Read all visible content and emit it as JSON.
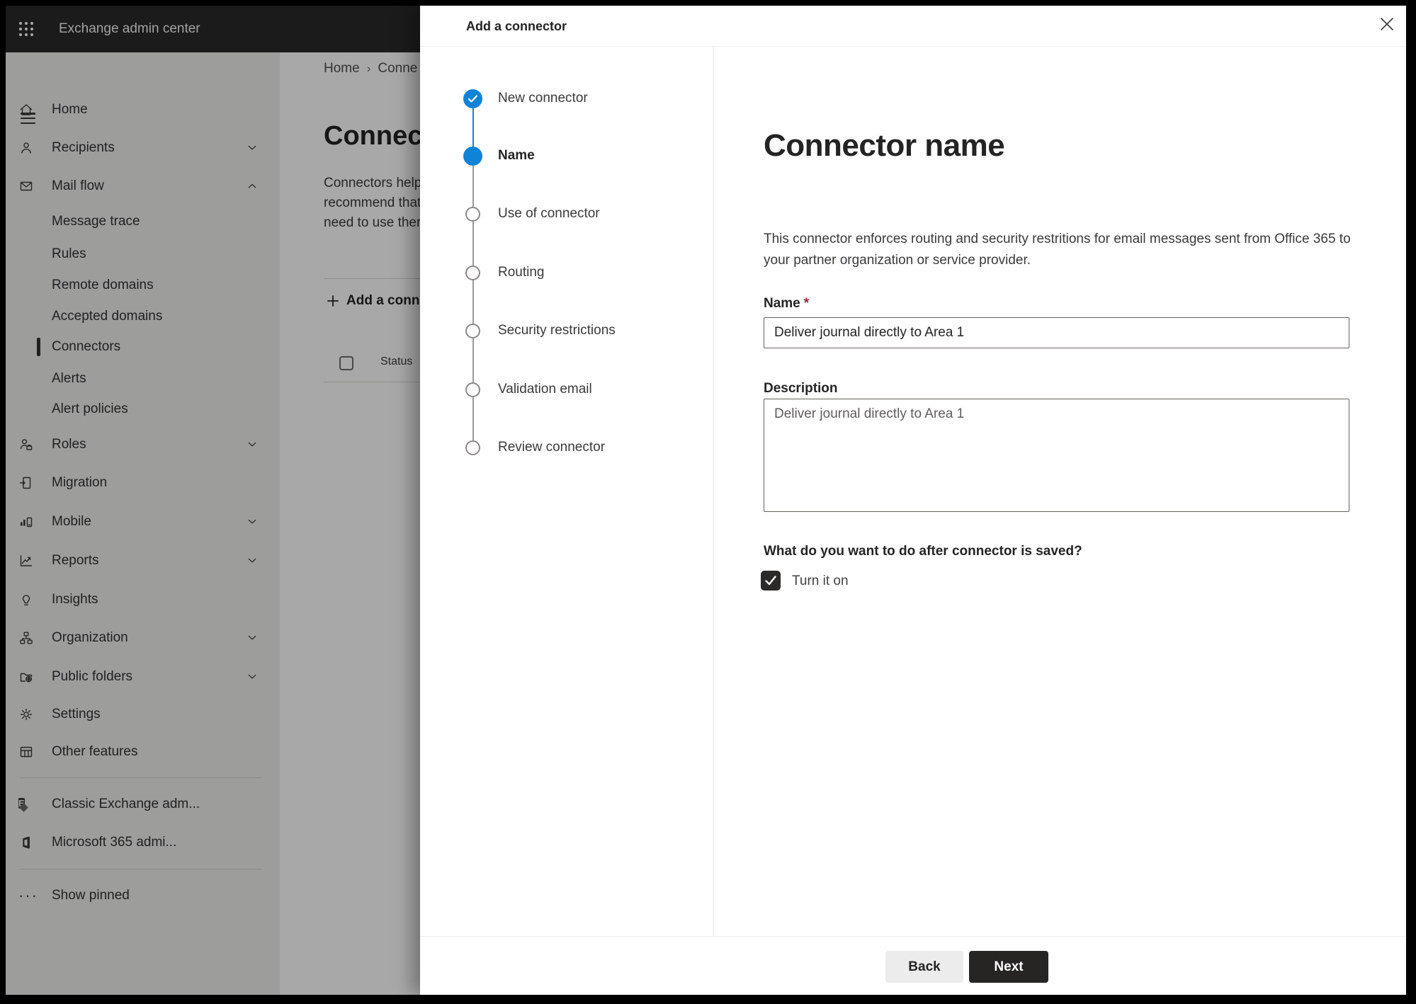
{
  "topbar": {
    "title": "Exchange admin center",
    "app_launcher_icon": "waffle-grid"
  },
  "sidebar": {
    "menu_icon": "hamburger",
    "items": [
      {
        "label": "Home",
        "icon": "home-icon"
      },
      {
        "label": "Recipients",
        "icon": "person-icon",
        "chevron": "down"
      },
      {
        "label": "Mail flow",
        "icon": "mail-icon",
        "chevron": "up",
        "expanded": true
      },
      {
        "label": "Message trace",
        "indent": true
      },
      {
        "label": "Rules",
        "indent": true
      },
      {
        "label": "Remote domains",
        "indent": true
      },
      {
        "label": "Accepted domains",
        "indent": true
      },
      {
        "label": "Connectors",
        "indent": true,
        "selected": true
      },
      {
        "label": "Alerts",
        "indent": true
      },
      {
        "label": "Alert policies",
        "indent": true
      },
      {
        "label": "Roles",
        "icon": "roles-icon",
        "chevron": "down"
      },
      {
        "label": "Migration",
        "icon": "migration-icon"
      },
      {
        "label": "Mobile",
        "icon": "mobile-icon",
        "chevron": "down"
      },
      {
        "label": "Reports",
        "icon": "reports-icon",
        "chevron": "down"
      },
      {
        "label": "Insights",
        "icon": "insights-icon"
      },
      {
        "label": "Organization",
        "icon": "organization-icon",
        "chevron": "down"
      },
      {
        "label": "Public folders",
        "icon": "public-folders-icon",
        "chevron": "down"
      },
      {
        "label": "Settings",
        "icon": "settings-icon"
      },
      {
        "label": "Other features",
        "icon": "other-features-icon"
      },
      {
        "label": "Classic Exchange adm...",
        "icon": "classic-exchange-icon"
      },
      {
        "label": "Microsoft 365 admi...",
        "icon": "microsoft-365-icon"
      },
      {
        "label": "Show pinned",
        "icon": "ellipsis-icon"
      }
    ]
  },
  "background_page": {
    "breadcrumb": {
      "home": "Home",
      "separator": "›",
      "current": "Conne"
    },
    "heading": "Connec",
    "intro_lines": [
      "Connectors help",
      "recommend that",
      "need to use ther"
    ],
    "add_connector_button": "Add a conn",
    "table": {
      "status_header": "Status",
      "select_all_checked": false
    }
  },
  "dialog": {
    "title": "Add a connector",
    "close_icon": "x-icon",
    "steps": [
      {
        "label": "New connector",
        "state": "completed"
      },
      {
        "label": "Name",
        "state": "current"
      },
      {
        "label": "Use of connector",
        "state": "upcoming"
      },
      {
        "label": "Routing",
        "state": "upcoming"
      },
      {
        "label": "Security restrictions",
        "state": "upcoming"
      },
      {
        "label": "Validation email",
        "state": "upcoming"
      },
      {
        "label": "Review connector",
        "state": "upcoming"
      }
    ],
    "content": {
      "heading": "Connector name",
      "description": "This connector enforces routing and security restritions for email messages sent from Office 365 to your partner organization or service provider.",
      "name_label": "Name",
      "required_mark": "*",
      "name_value": "Deliver journal directly to Area 1",
      "description_label": "Description",
      "description_value": "Deliver journal directly to Area 1",
      "after_save_question": "What do you want to do after connector is saved?",
      "turn_it_on_label": "Turn it on",
      "turn_it_on_checked": true
    },
    "footer": {
      "back": "Back",
      "next": "Next"
    }
  },
  "colors": {
    "accent_blue": "#0f83d8",
    "required_red": "#a4262c",
    "topbar_bg": "#2b2a29",
    "next_button_bg": "#262524",
    "dim_overlay": "rgba(0,0,0,0.34)"
  }
}
